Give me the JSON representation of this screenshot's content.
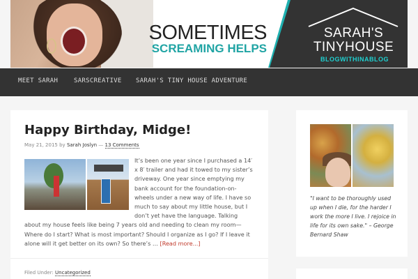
{
  "header": {
    "tagline_line1": "SOMETIMES",
    "tagline_line2": "SCREAMING HELPS",
    "logo_line1": "SARAH'S",
    "logo_line2": "TINYHOUSE",
    "logo_line3": "BLOGWITHINABLOG",
    "accent_color": "#1fb0b0",
    "dark_color": "#333333"
  },
  "nav": {
    "items": [
      {
        "label": "MEET SARAH"
      },
      {
        "label": "SARSCREATIVE"
      },
      {
        "label": "SARAH'S TINY HOUSE ADVENTURE"
      }
    ]
  },
  "post": {
    "title": "Happy Birthday, Midge!",
    "date": "May 21, 2015",
    "by": "by",
    "author": "Sarah Joslyn",
    "sep": "—",
    "comments": "13 Comments",
    "body": "It’s been one year since I purchased a 14′ x 8′ trailer and had it towed to my sister’s driveway. One year since emptying my bank account for the foundation-on-wheels under a new way of life. I have so much to say about my little house, but I don’t yet have the language. Talking about my house feels like being 7 years old and needing to clean my room—Where do I start? What is most important? Should I organize as I go? If I leave it alone will it get better on its own? So there’s …",
    "read_more": "[Read more...]",
    "filed_under": "Filed Under:",
    "category": "Uncategorized"
  },
  "sidebar": {
    "quote": "\"I want to be thoroughly used up when I die, for the harder I work the more I live. I rejoice in life for its own sake.\" – George Bernard Shaw"
  }
}
